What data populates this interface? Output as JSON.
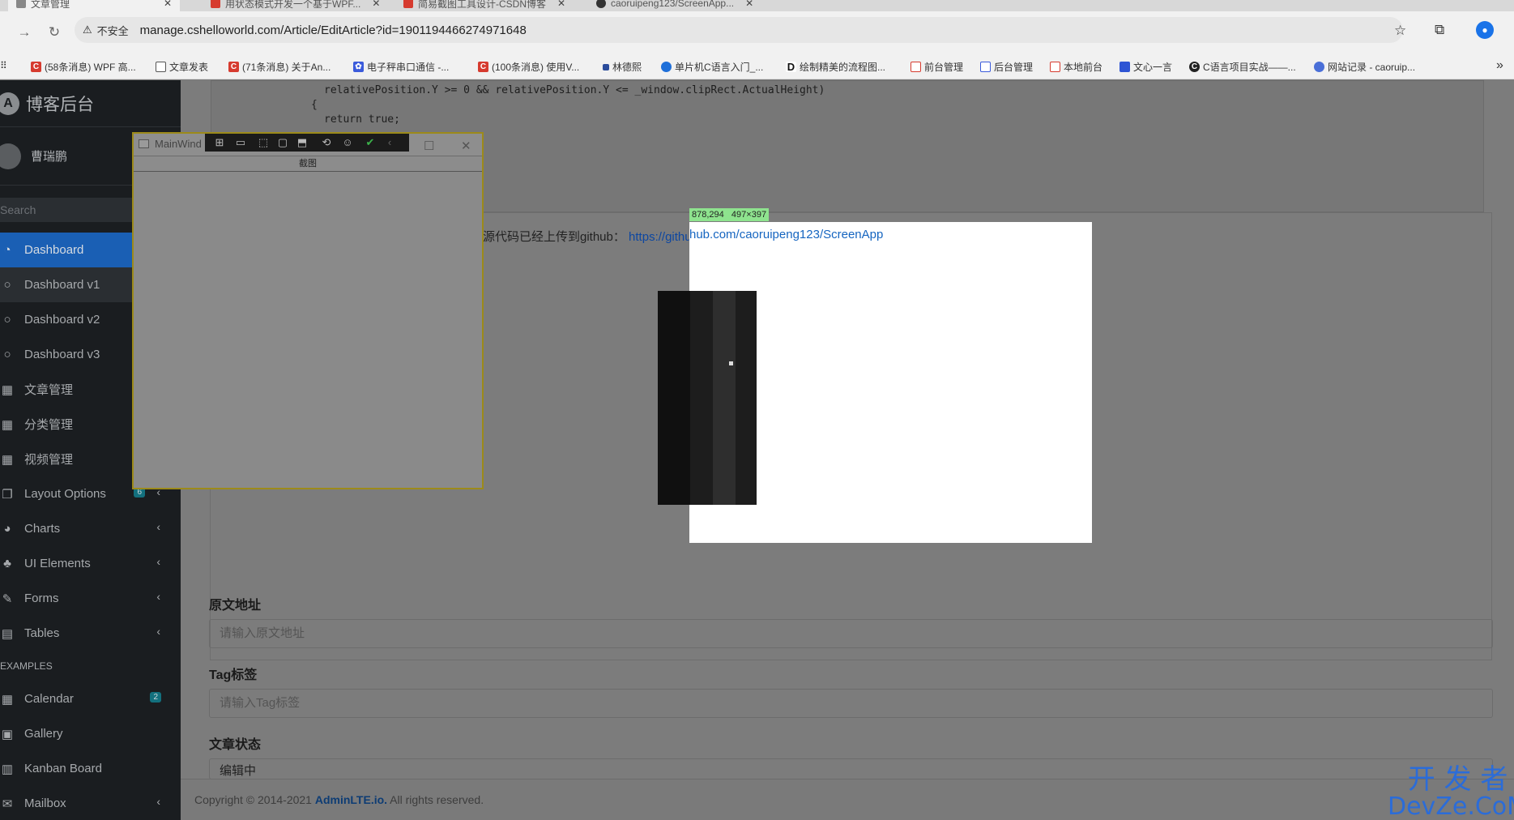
{
  "browser": {
    "tabs": [
      {
        "title": "文章管理"
      },
      {
        "title": "用状态模式开发一个基于WPF..."
      },
      {
        "title": "简易截图工具设计-CSDN博客"
      },
      {
        "title": "caoruipeng123/ScreenApp..."
      }
    ],
    "security_label": "不安全",
    "url": "manage.cshelloworld.com/Article/EditArticle?id=1901194466274971648",
    "bookmarks": [
      "(58条消息) WPF 高...",
      "文章发表",
      "(71条消息) 关于An...",
      "电子秤串口通信 -...",
      "(100条消息) 使用V...",
      "林德熙",
      "单片机C语言入门_...",
      "绘制精美的流程图...",
      "前台管理",
      "后台管理",
      "本地前台",
      "文心一言",
      "C语言项目实战——...",
      "网站记录 - caoruip..."
    ]
  },
  "sidebar": {
    "brand": "博客后台",
    "user_name": "曹瑞鹏",
    "search_placeholder": "Search",
    "items": [
      {
        "label": "Dashboard"
      },
      {
        "label": "Dashboard v1"
      },
      {
        "label": "Dashboard v2"
      },
      {
        "label": "Dashboard v3"
      },
      {
        "label": "文章管理"
      },
      {
        "label": "分类管理"
      },
      {
        "label": "视频管理"
      },
      {
        "label": "Layout Options",
        "badge": "6"
      },
      {
        "label": "Charts"
      },
      {
        "label": "UI Elements"
      },
      {
        "label": "Forms"
      },
      {
        "label": "Tables"
      }
    ],
    "examples_header": "EXAMPLES",
    "examples": [
      {
        "label": "Calendar",
        "badge": "2"
      },
      {
        "label": "Gallery"
      },
      {
        "label": "Kanban Board"
      },
      {
        "label": "Mailbox"
      }
    ]
  },
  "main": {
    "code_lines": [
      "relativePosition.Y >= 0 && relativePosition.Y <= _window.clipRect.ActualHeight)",
      "{",
      "return true;"
    ],
    "article_text": "源代码已经上传到github：",
    "article_link": "https://github.com/caoruipeng123/ScreenApp",
    "fields": [
      {
        "label": "原文地址",
        "placeholder": "请输入原文地址"
      },
      {
        "label": "Tag标签",
        "placeholder": "请输入Tag标签"
      },
      {
        "label": "文章状态",
        "value": "编辑中"
      }
    ],
    "footer_prefix": "Copyright © 2014-2021 ",
    "footer_link": "AdminLTE.io.",
    "footer_suffix": " All rights reserved."
  },
  "tool_window": {
    "title": "MainWind",
    "capture_button": "截图"
  },
  "selection": {
    "info": "878,294   497×397",
    "link_fragment": "hub.com/caoruipeng123/ScreenApp"
  },
  "watermark": {
    "line1": "开 发 者",
    "line2": "DevZe.CoM"
  }
}
